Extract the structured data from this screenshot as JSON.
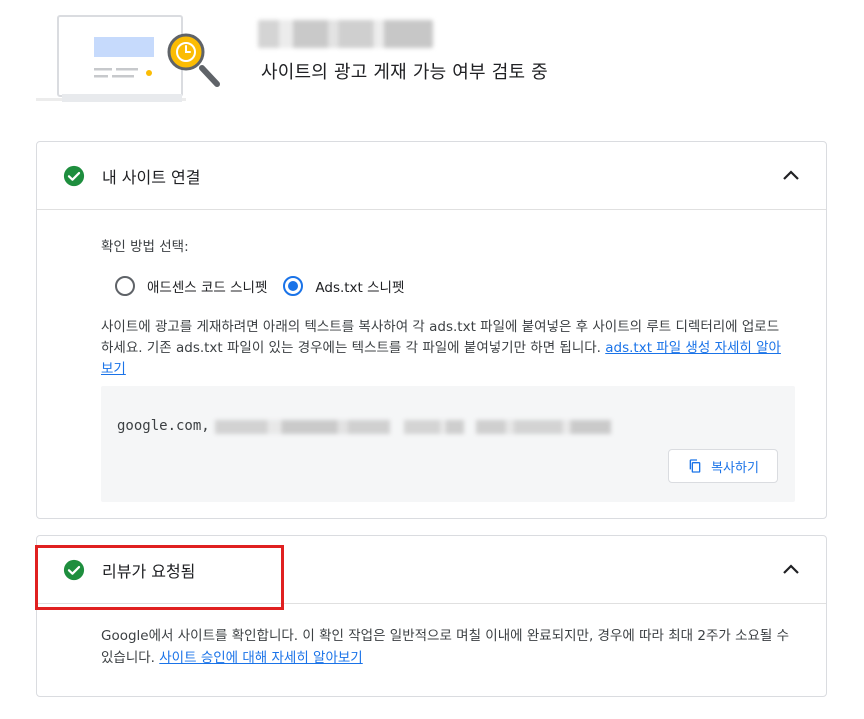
{
  "header": {
    "subtitle": "사이트의 광고 게재 가능 여부 검토 중",
    "illustration_icon": "site-review-magnifier-clock"
  },
  "card_connect": {
    "title": "내 사이트 연결",
    "status_icon": "check-circle-icon",
    "method_label": "확인 방법 선택:",
    "options": [
      {
        "label": "애드센스 코드 스니펫",
        "selected": false
      },
      {
        "label": "Ads.txt 스니펫",
        "selected": true
      }
    ],
    "instructions": "사이트에 광고를 게재하려면 아래의 텍스트를 복사하여 각 ads.txt 파일에 붙여넣은 후 사이트의 루트 디렉터리에 업로드하세요. 기존 ads.txt 파일이 있는 경우에는 텍스트를 각 파일에 붙여넣기만 하면 됩니다. ",
    "learn_more_link": "ads.txt 파일 생성 자세히 알아보기",
    "code_prefix": "google.com,",
    "copy_button": "복사하기"
  },
  "card_review": {
    "title": "리뷰가 요청됨",
    "status_icon": "check-circle-icon",
    "text": "Google에서 사이트를 확인합니다. 이 확인 작업은 일반적으로 며칠 이내에 완료되지만, 경우에 따라 최대 2주가 소요될 수 있습니다. ",
    "learn_more_link": "사이트 승인에 대해 자세히 알아보기"
  },
  "colors": {
    "success": "#1e8e3e",
    "accent": "#1a73e8",
    "highlight": "#e02020",
    "illustration_yellow": "#fbbc04"
  }
}
